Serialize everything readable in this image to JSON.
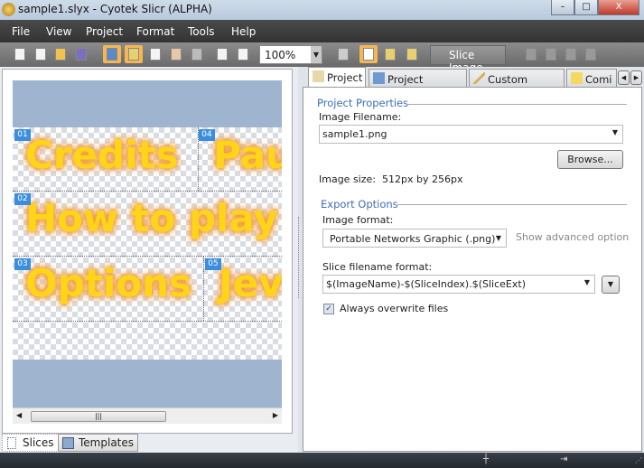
{
  "window": {
    "title": "sample1.slyx - Cyotek Slicr (ALPHA)",
    "minimize": "–",
    "maximize": "□",
    "close": "X"
  },
  "menu": [
    "File",
    "View",
    "Project",
    "Format",
    "Tools",
    "Help"
  ],
  "toolbar": {
    "zoom": "100%",
    "slice_image": "Slice Image"
  },
  "canvas": {
    "words": [
      "Credits",
      "Pau",
      "How to play",
      "Options",
      "Jev"
    ],
    "slices": [
      "01",
      "02",
      "03",
      "04",
      "05"
    ]
  },
  "left_tabs": [
    "Slices",
    "Templates"
  ],
  "right_tabs": [
    "Project",
    "Project Explorer",
    "Custom Fields",
    "Comi"
  ],
  "project": {
    "properties_header": "Project Properties",
    "image_filename_label": "Image Filename:",
    "image_filename": "sample1.png",
    "browse": "Browse...",
    "image_size_label": "Image size:",
    "image_size": "512px by 256px",
    "export_header": "Export Options",
    "image_format_label": "Image format:",
    "image_format": "Portable Networks Graphic (.png)",
    "show_advanced": "Show advanced option",
    "slice_format_label": "Slice filename format:",
    "slice_format": "$(ImageName)-$(SliceIndex).$(SliceExt)",
    "overwrite_label": "Always overwrite files",
    "overwrite_checked": true
  }
}
